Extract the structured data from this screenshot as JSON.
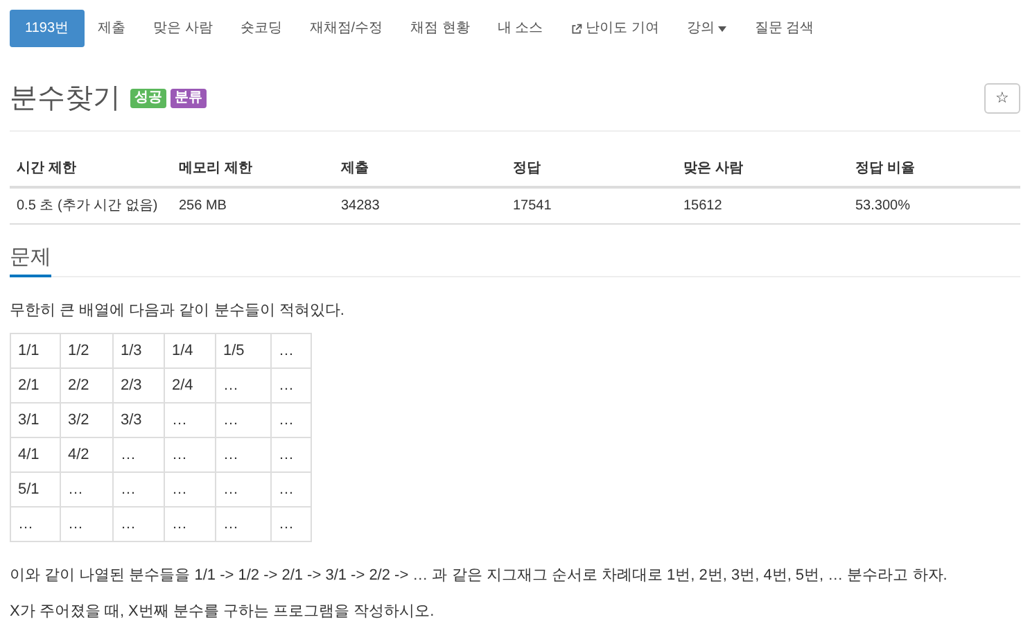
{
  "nav": [
    {
      "label": "1193번",
      "selected": true
    },
    {
      "label": "제출",
      "selected": false
    },
    {
      "label": "맞은 사람",
      "selected": false
    },
    {
      "label": "숏코딩",
      "selected": false
    },
    {
      "label": "재채점/수정",
      "selected": false
    },
    {
      "label": "채점 현황",
      "selected": false
    },
    {
      "label": "내 소스",
      "selected": false
    },
    {
      "label": "난이도 기여",
      "selected": false,
      "kind": "external"
    },
    {
      "label": "강의",
      "selected": false,
      "kind": "dropdown"
    },
    {
      "label": "질문 검색",
      "selected": false
    }
  ],
  "title": "분수찾기",
  "badges": [
    {
      "label": "성공",
      "color": "#5cb85c"
    },
    {
      "label": "분류",
      "color": "#9b59b6"
    }
  ],
  "star_button": "☆",
  "stats": {
    "columns": [
      "시간 제한",
      "메모리 제한",
      "제출",
      "정답",
      "맞은 사람",
      "정답 비율"
    ],
    "row": [
      "0.5 초 (추가 시간 없음)",
      "256 MB",
      "34283",
      "17541",
      "15612",
      "53.300%"
    ]
  },
  "section_heading": "문제",
  "intro": "무한히 큰 배열에 다음과 같이 분수들이 적혀있다.",
  "grid": [
    [
      "1/1",
      "1/2",
      "1/3",
      "1/4",
      "1/5",
      "…"
    ],
    [
      "2/1",
      "2/2",
      "2/3",
      "2/4",
      "…",
      "…"
    ],
    [
      "3/1",
      "3/2",
      "3/3",
      "…",
      "…",
      "…"
    ],
    [
      "4/1",
      "4/2",
      "…",
      "…",
      "…",
      "…"
    ],
    [
      "5/1",
      "…",
      "…",
      "…",
      "…",
      "…"
    ],
    [
      "…",
      "…",
      "…",
      "…",
      "…",
      "…"
    ]
  ],
  "paragraphs": [
    "이와 같이 나열된 분수들을 1/1 -> 1/2 -> 2/1 -> 3/1 -> 2/2 -> … 과 같은 지그재그 순서로 차례대로 1번, 2번, 3번, 4번, 5번, … 분수라고 하자.",
    "X가 주어졌을 때, X번째 분수를 구하는 프로그램을 작성하시오."
  ]
}
